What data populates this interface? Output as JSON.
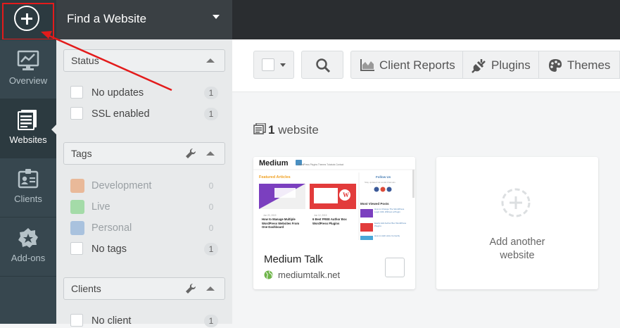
{
  "rail": {
    "items": [
      {
        "label": "Overview",
        "icon": "chart-icon"
      },
      {
        "label": "Websites",
        "icon": "websites-icon",
        "active": true
      },
      {
        "label": "Clients",
        "icon": "client-card-icon"
      },
      {
        "label": "Add-ons",
        "icon": "badge-plus-icon"
      }
    ]
  },
  "panel": {
    "title": "Find a Website",
    "status": {
      "label": "Status",
      "items": [
        {
          "label": "No updates",
          "count": "1"
        },
        {
          "label": "SSL enabled",
          "count": "1"
        }
      ]
    },
    "tags": {
      "label": "Tags",
      "items": [
        {
          "label": "Development",
          "count": "0",
          "color": "#e9b999"
        },
        {
          "label": "Live",
          "count": "0",
          "color": "#a4dba8"
        },
        {
          "label": "Personal",
          "count": "0",
          "color": "#a9c2de"
        },
        {
          "label": "No tags",
          "count": "1"
        }
      ]
    },
    "clients": {
      "label": "Clients",
      "items": [
        {
          "label": "No client",
          "count": "1"
        }
      ]
    }
  },
  "toolbar": {
    "client_reports": "Client Reports",
    "plugins": "Plugins",
    "themes": "Themes"
  },
  "main": {
    "count_number": "1",
    "count_label": "website",
    "site": {
      "name": "Medium Talk",
      "url": "mediumtalk.net",
      "thumb": {
        "logo": "Medium",
        "nav": "WordPress Plugins   Themes   Tutorials   Contact",
        "featured": "Featured Articles",
        "post1": "How to Manage Multiple WordPress Websites From One Dashboard",
        "post2": "6 Best FREE Author Box WordPress Plugins",
        "date1": "Jun 20, 2019",
        "date2": "Jun 12, 2019",
        "follow": "Follow Us",
        "follow_sub": "Stay updated via social channels",
        "most_viewed": "Most Viewed Posts",
        "mv1": "How to Change The WordPress Login URL Without a Plugin",
        "mv2": "Easily Add Author Box WordPress Plugins",
        "mv3": "How to Add Links Correctly"
      }
    },
    "add_card_label": "Add another website"
  },
  "colors": {
    "highlight": "#e31b1b",
    "rail_bg": "#37474f",
    "topbar_bg": "#2a2d30",
    "site_globe": "#6fb54a"
  }
}
